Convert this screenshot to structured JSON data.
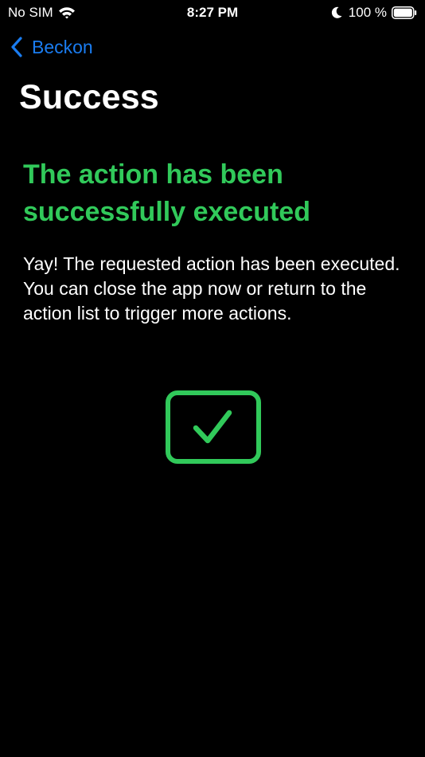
{
  "status_bar": {
    "carrier": "No SIM",
    "time": "8:27 PM",
    "battery": "100 %",
    "icons": [
      "wifi-icon",
      "moon-icon",
      "battery-icon"
    ]
  },
  "nav": {
    "back_label": "Beckon",
    "back_icon": "chevron-left-icon"
  },
  "page": {
    "title": "Success",
    "heading": "The action has been successfully executed",
    "message": "Yay! The requested action has been executed. You can close the app now or return to the action list to trigger more actions.",
    "status_icon": "checkmark-square-icon"
  },
  "colors": {
    "background": "#000000",
    "accent_blue": "#1a7cf0",
    "success_green": "#31c95a",
    "text": "#ffffff"
  }
}
